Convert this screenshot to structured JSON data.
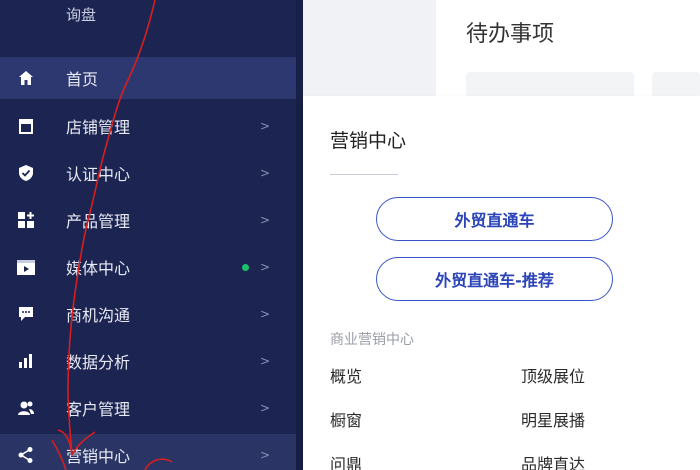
{
  "sidebar": {
    "top_item": "询盘",
    "items": [
      {
        "label": "首页",
        "icon": "home-icon",
        "arrow": ""
      },
      {
        "label": "店铺管理",
        "icon": "store-icon",
        "arrow": ">"
      },
      {
        "label": "认证中心",
        "icon": "shield-check-icon",
        "arrow": ">"
      },
      {
        "label": "产品管理",
        "icon": "grid-plus-icon",
        "arrow": ">"
      },
      {
        "label": "媒体中心",
        "icon": "play-video-icon",
        "arrow": ">"
      },
      {
        "label": "商机沟通",
        "icon": "chat-bubble-icon",
        "arrow": ">"
      },
      {
        "label": "数据分析",
        "icon": "bar-chart-icon",
        "arrow": ">"
      },
      {
        "label": "客户管理",
        "icon": "users-icon",
        "arrow": ">"
      },
      {
        "label": "营销中心",
        "icon": "share-nodes-icon",
        "arrow": ">"
      }
    ]
  },
  "main": {
    "todo_title": "待办事项"
  },
  "popover": {
    "title": "营销中心",
    "button_1": "外贸直通车",
    "button_2": "外贸直通车-推荐",
    "section_label": "商业营销中心",
    "links_left": [
      "概览",
      "橱窗",
      "问鼎"
    ],
    "links_right": [
      "顶级展位",
      "明星展播",
      "品牌直达"
    ]
  },
  "colors": {
    "sidebar_bg": "#1c2552",
    "sidebar_active": "#2d3870",
    "accent_blue": "#3a55c8",
    "status_dot": "#19c36b",
    "annotation_red": "#d81e1e"
  }
}
